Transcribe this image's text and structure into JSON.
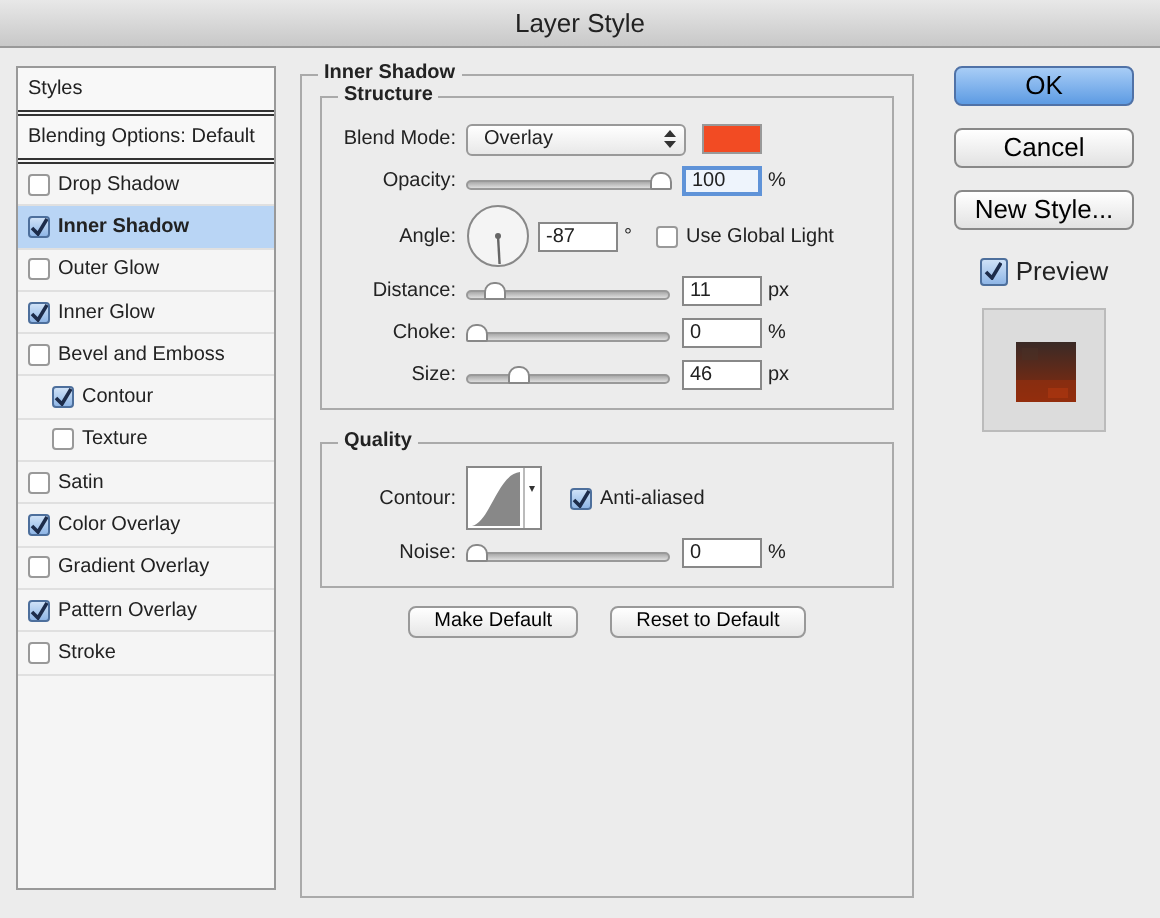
{
  "window": {
    "title": "Layer Style"
  },
  "styles_list": [
    {
      "kind": "header",
      "label": "Styles",
      "selected": false
    },
    {
      "kind": "header",
      "label": "Blending Options: Default",
      "selected": false
    },
    {
      "kind": "effect",
      "label": "Drop Shadow",
      "checked": false,
      "selected": false
    },
    {
      "kind": "effect",
      "label": "Inner Shadow",
      "checked": true,
      "selected": true
    },
    {
      "kind": "effect",
      "label": "Outer Glow",
      "checked": false,
      "selected": false
    },
    {
      "kind": "effect",
      "label": "Inner Glow",
      "checked": true,
      "selected": false
    },
    {
      "kind": "effect",
      "label": "Bevel and Emboss",
      "checked": false,
      "selected": false,
      "children": [
        {
          "kind": "effect",
          "label": "Contour",
          "checked": true,
          "selected": false
        },
        {
          "kind": "effect",
          "label": "Texture",
          "checked": false,
          "selected": false
        }
      ]
    },
    {
      "kind": "effect",
      "label": "Satin",
      "checked": false,
      "selected": false
    },
    {
      "kind": "effect",
      "label": "Color Overlay",
      "checked": true,
      "selected": false
    },
    {
      "kind": "effect",
      "label": "Gradient Overlay",
      "checked": false,
      "selected": false
    },
    {
      "kind": "effect",
      "label": "Pattern Overlay",
      "checked": true,
      "selected": false
    },
    {
      "kind": "effect",
      "label": "Stroke",
      "checked": false,
      "selected": false
    }
  ],
  "panel": {
    "title": "Inner Shadow",
    "structure": {
      "title": "Structure",
      "rows": [
        {
          "kind": "select",
          "label": "Blend Mode:",
          "value": "Overlay",
          "color": "#f24b23"
        },
        {
          "kind": "slider",
          "label": "Opacity:",
          "level": 1.0,
          "value": "100",
          "unit": "%",
          "focused": true
        },
        {
          "kind": "angle",
          "label": "Angle:",
          "value": "-87",
          "unit": "°",
          "checkbox": {
            "label": "Use Global Light",
            "checked": false
          }
        },
        {
          "kind": "slider",
          "label": "Distance:",
          "level": 0.1,
          "value": "11",
          "unit": "px",
          "focused": false
        },
        {
          "kind": "slider",
          "label": "Choke:",
          "level": 0.0,
          "value": "0",
          "unit": "%",
          "focused": false
        },
        {
          "kind": "slider",
          "label": "Size:",
          "level": 0.23,
          "value": "46",
          "unit": "px",
          "focused": false
        }
      ]
    },
    "quality": {
      "title": "Quality",
      "rows": [
        {
          "kind": "contour",
          "label": "Contour:",
          "checkbox": {
            "label": "Anti-aliased",
            "checked": true
          }
        },
        {
          "kind": "slider",
          "label": "Noise:",
          "level": 0.0,
          "value": "0",
          "unit": "%",
          "focused": false
        }
      ]
    },
    "buttons": [
      "Make Default",
      "Reset to Default"
    ]
  },
  "actions": [
    {
      "label": "OK",
      "default": true
    },
    {
      "label": "Cancel",
      "default": false
    },
    {
      "label": "New Style...",
      "default": false
    }
  ],
  "preview": {
    "label": "Preview",
    "checked": true
  }
}
